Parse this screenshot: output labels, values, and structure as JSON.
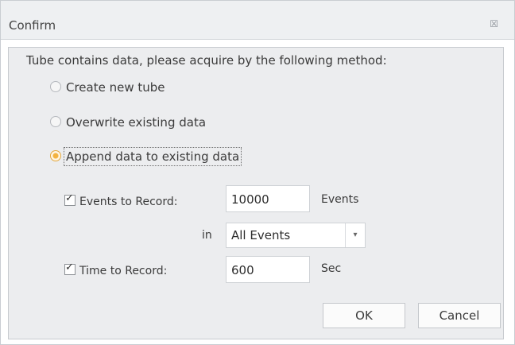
{
  "dialog": {
    "title": "Confirm",
    "close_glyph": "☒",
    "prompt": "Tube contains data, please acquire by the following method:"
  },
  "radios": [
    {
      "label": "Create new tube",
      "selected": false
    },
    {
      "label": "Overwrite existing data",
      "selected": false
    },
    {
      "label": "Append data to existing data",
      "selected": true
    }
  ],
  "events_to_record": {
    "checked": true,
    "label": "Events to Record:",
    "value": "10000",
    "unit": "Events"
  },
  "in_select": {
    "label": "in",
    "value": "All Events",
    "arrow": "▾"
  },
  "time_to_record": {
    "checked": true,
    "label": "Time to Record:",
    "value": "600",
    "unit": "Sec"
  },
  "buttons": {
    "ok": "OK",
    "cancel": "Cancel"
  },
  "colors": {
    "radio_selected": "#f3b23f",
    "panel_bg": "#ecedef",
    "titlebar_bg": "#eef0f2"
  }
}
